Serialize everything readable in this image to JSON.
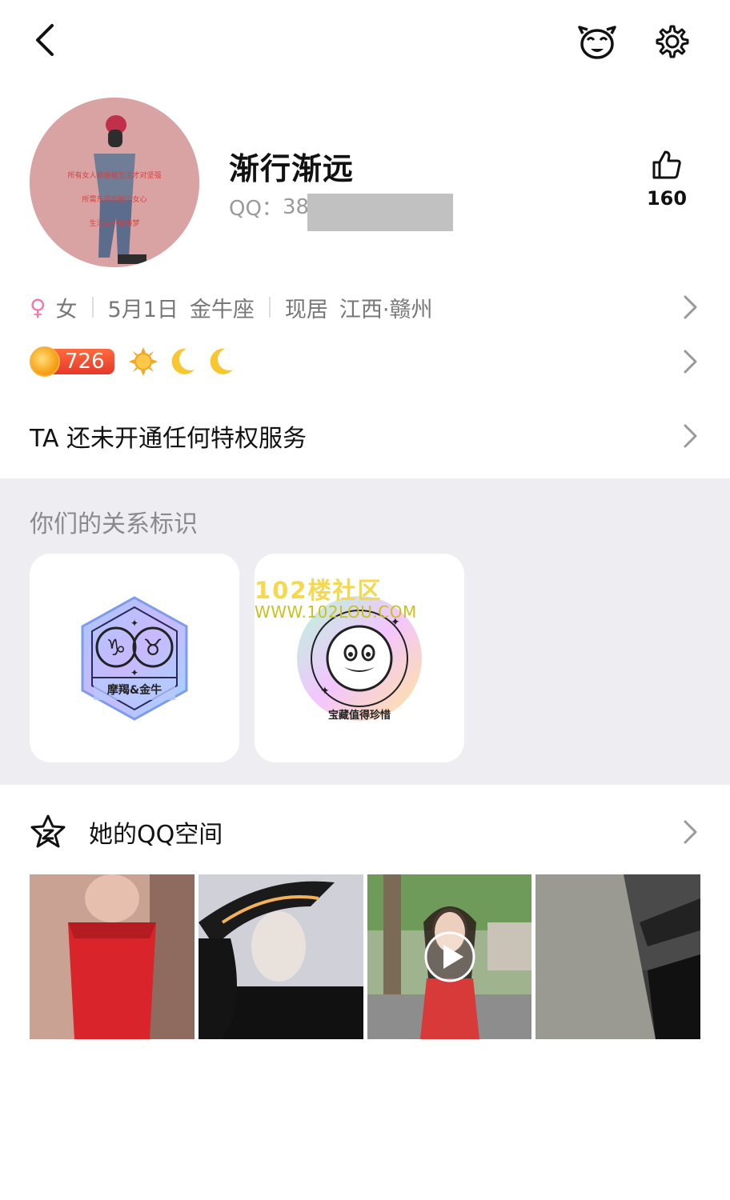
{
  "header": {
    "back_icon": "back-arrow-icon",
    "pet_icon": "pet-face-icon",
    "settings_icon": "gear-icon"
  },
  "profile": {
    "nickname": "渐行渐远",
    "qq_label": "QQ：",
    "qq_prefix": "38",
    "likes": "160",
    "avatar_text_lines": [
      "所有女人都是被生活才对坚强",
      "所需东风吹破少女心",
      "生活有千般难梦"
    ]
  },
  "info": {
    "gender_symbol": "♀",
    "gender": "女",
    "birthday": "5月1日",
    "zodiac": "金牛座",
    "location_prefix": "现居",
    "location": "江西·赣州"
  },
  "level": {
    "coin_value": "726",
    "icons": [
      "sun-icon",
      "moon-icon",
      "moon-icon"
    ],
    "colors": {
      "coin_pill": "#e6392a",
      "sun": "#f5a623",
      "moon": "#f8c630"
    }
  },
  "vip": {
    "text": "TA 还未开通任何特权服务"
  },
  "relation": {
    "title": "你们的关系标识",
    "badge1_label": "摩羯&金牛",
    "badge2_label": "宝藏值得珍惜",
    "watermark_line1": "102楼社区",
    "watermark_line2": "WWW.102LOU.COM"
  },
  "qzone": {
    "title": "她的QQ空间",
    "photos": [
      "photo-red-dress",
      "photo-black-hat",
      "photo-street-video",
      "photo-car-seat"
    ],
    "video_photo_index": 2
  },
  "colors": {
    "gray_bg": "#eeeef2",
    "text_primary": "#111111",
    "text_secondary": "#777777",
    "gender_pink": "#f07ab0"
  }
}
